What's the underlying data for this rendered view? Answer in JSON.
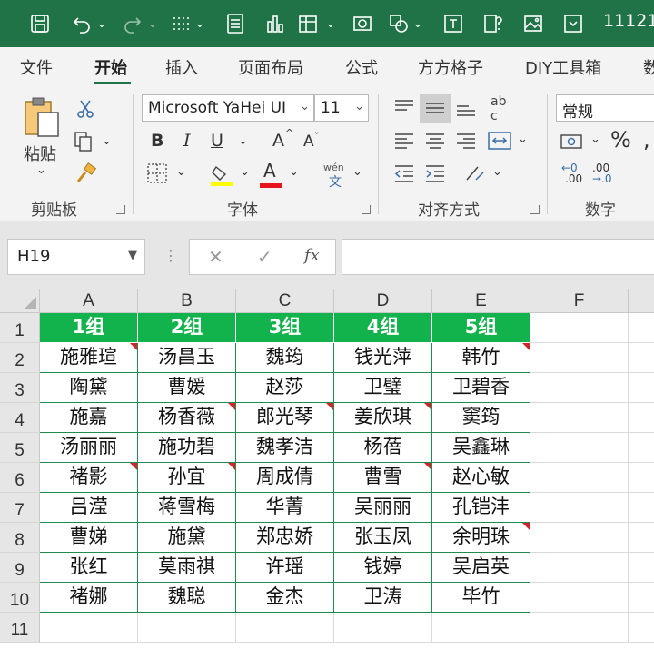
{
  "title_bar": {
    "file_name": "11121",
    "bg_color": "#207346"
  },
  "tabs": [
    "文件",
    "开始",
    "插入",
    "页面布局",
    "公式",
    "方方格子",
    "DIY工具箱",
    "数"
  ],
  "active_tab": "开始",
  "ribbon": {
    "clipboard": {
      "paste_label": "粘贴",
      "group_label": "剪贴板"
    },
    "font": {
      "font_name": "Microsoft YaHei UI",
      "font_size": "11",
      "bold": "B",
      "italic": "I",
      "underline": "U",
      "grow": "A",
      "shrink": "A",
      "font_color_glyph": "A",
      "phonetic_top": "wén",
      "phonetic_bottom": "文",
      "group_label": "字体"
    },
    "alignment": {
      "wrap_glyph": "ab c",
      "group_label": "对齐方式"
    },
    "number": {
      "format": "常规",
      "percent": "%",
      "inc_dec_1": "←0",
      "inc_dec_2": ".00",
      "dec_dec_1": ".00",
      "dec_dec_2": "→.0",
      "group_label": "数字"
    },
    "accent_color": "#217346"
  },
  "formula_bar": {
    "name_box": "H19",
    "fx": "fx",
    "formula": ""
  },
  "sheet": {
    "columns": [
      "A",
      "B",
      "C",
      "D",
      "E",
      "F"
    ],
    "rows": [
      "1",
      "2",
      "3",
      "4",
      "5",
      "6",
      "7",
      "8",
      "9",
      "10",
      "11"
    ],
    "header_fill": "#12b24c",
    "header_row": [
      "1组",
      "2组",
      "3组",
      "4组",
      "5组"
    ],
    "data": [
      [
        "施雅瑄",
        "汤昌玉",
        "魏筠",
        "钱光萍",
        "韩竹"
      ],
      [
        "陶黛",
        "曹媛",
        "赵莎",
        "卫璧",
        "卫碧香"
      ],
      [
        "施嘉",
        "杨香薇",
        "郎光琴",
        "姜欣琪",
        "窦筠"
      ],
      [
        "汤丽丽",
        "施功碧",
        "魏孝洁",
        "杨蓓",
        "吴鑫琳"
      ],
      [
        "褚影",
        "孙宜",
        "周成倩",
        "曹雪",
        "赵心敏"
      ],
      [
        "吕滢",
        "蒋雪梅",
        "华菁",
        "吴丽丽",
        "孔铠沣"
      ],
      [
        "曹娣",
        "施黛",
        "郑忠娇",
        "张玉凤",
        "余明珠"
      ],
      [
        "张红",
        "莫雨祺",
        "许瑶",
        "钱婷",
        "吴启英"
      ],
      [
        "褚娜",
        "魏聪",
        "金杰",
        "卫涛",
        "毕竹"
      ]
    ]
  }
}
